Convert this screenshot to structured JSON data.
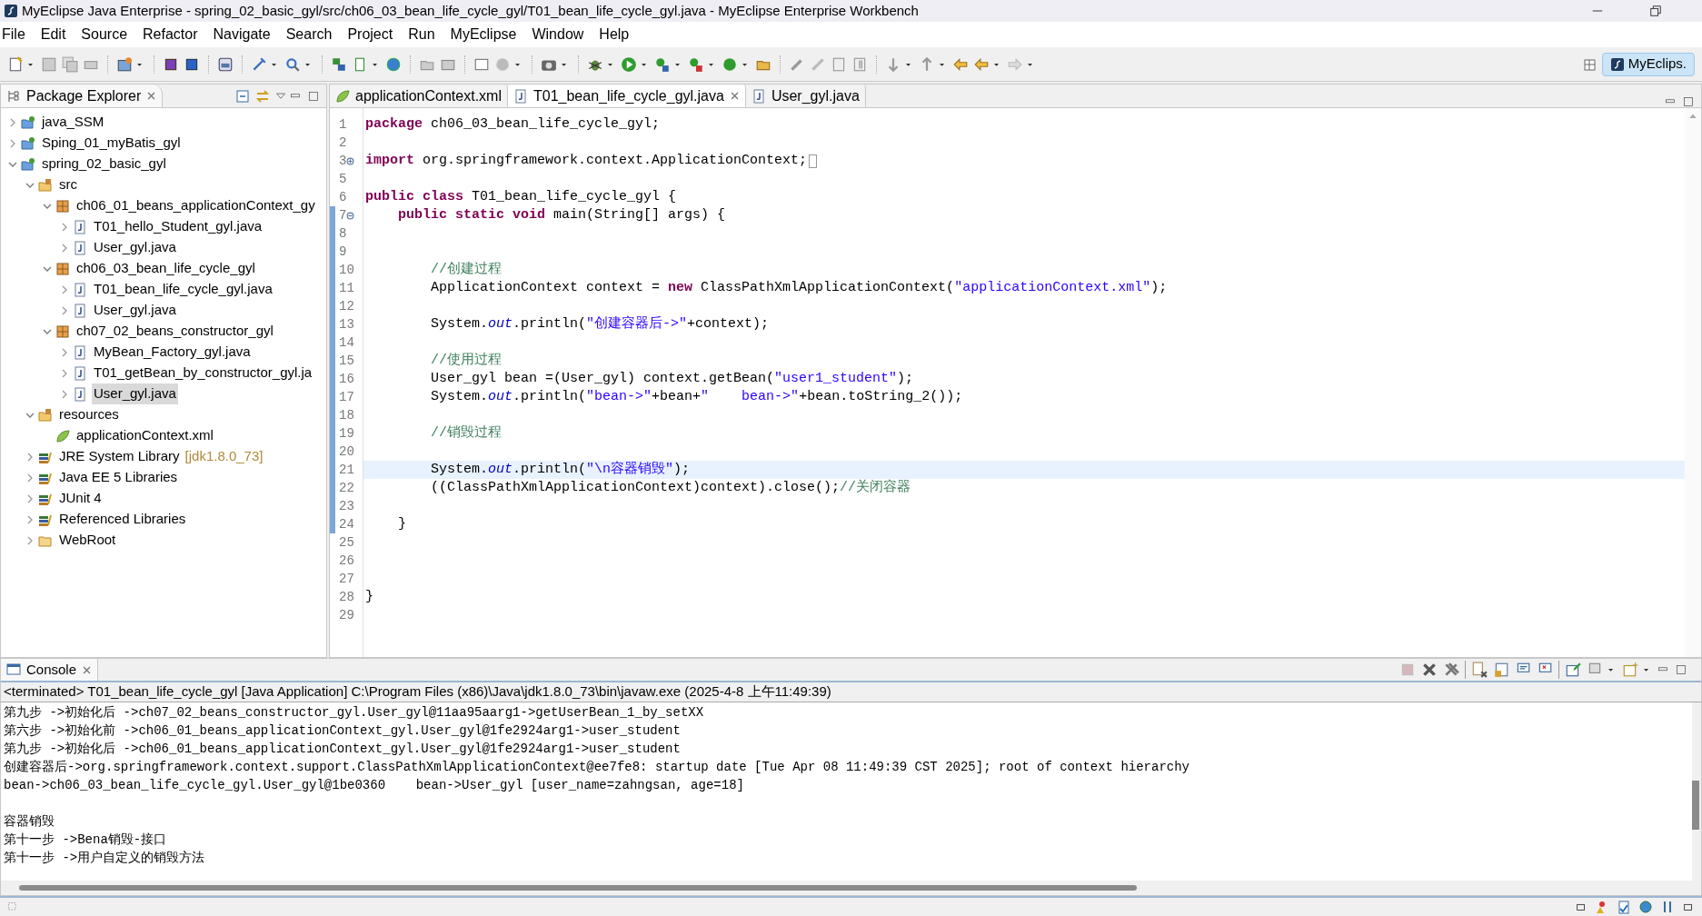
{
  "window": {
    "title": "MyEclipse Java Enterprise - spring_02_basic_gyl/src/ch06_03_bean_life_cycle_gyl/T01_bean_life_cycle_gyl.java - MyEclipse Enterprise Workbench"
  },
  "menu": [
    "File",
    "Edit",
    "Source",
    "Refactor",
    "Navigate",
    "Search",
    "Project",
    "Run",
    "MyEclipse",
    "Window",
    "Help"
  ],
  "perspective": {
    "label": "MyEclips.",
    "selected": true
  },
  "explorer": {
    "title": "Package Explorer",
    "tree": [
      {
        "label": "java_SSM",
        "kind": "project",
        "expanded": false
      },
      {
        "label": "Sping_01_myBatis_gyl",
        "kind": "project",
        "expanded": false
      },
      {
        "label": "spring_02_basic_gyl",
        "kind": "project",
        "expanded": true,
        "children": [
          {
            "label": "src",
            "kind": "source-folder",
            "expanded": true,
            "children": [
              {
                "label": "ch06_01_beans_applicationContext_gy",
                "kind": "package",
                "expanded": true,
                "children": [
                  {
                    "label": "T01_hello_Student_gyl.java",
                    "kind": "java",
                    "expanded": false,
                    "selected": false
                  },
                  {
                    "label": "User_gyl.java",
                    "kind": "java",
                    "expanded": false,
                    "selected": false
                  }
                ]
              },
              {
                "label": "ch06_03_bean_life_cycle_gyl",
                "kind": "package",
                "expanded": true,
                "children": [
                  {
                    "label": "T01_bean_life_cycle_gyl.java",
                    "kind": "java",
                    "expanded": false,
                    "selected": false
                  },
                  {
                    "label": "User_gyl.java",
                    "kind": "java",
                    "expanded": false,
                    "selected": false
                  }
                ]
              },
              {
                "label": "ch07_02_beans_constructor_gyl",
                "kind": "package",
                "expanded": true,
                "children": [
                  {
                    "label": "MyBean_Factory_gyl.java",
                    "kind": "java",
                    "expanded": false,
                    "selected": false
                  },
                  {
                    "label": "T01_getBean_by_constructor_gyl.ja",
                    "kind": "java",
                    "expanded": false,
                    "selected": false
                  },
                  {
                    "label": "User_gyl.java",
                    "kind": "java",
                    "expanded": false,
                    "selected": true
                  }
                ]
              }
            ]
          },
          {
            "label": "resources",
            "kind": "source-folder",
            "expanded": true,
            "children": [
              {
                "label": "applicationContext.xml",
                "kind": "xml",
                "selected": false
              }
            ]
          },
          {
            "label": "JRE System Library",
            "suffix": "[jdk1.8.0_73]",
            "kind": "library",
            "expanded": false
          },
          {
            "label": "Java EE 5 Libraries",
            "kind": "library",
            "expanded": false
          },
          {
            "label": "JUnit 4",
            "kind": "library",
            "expanded": false
          },
          {
            "label": "Referenced Libraries",
            "kind": "library",
            "expanded": false
          },
          {
            "label": "WebRoot",
            "kind": "folder",
            "expanded": false
          }
        ]
      }
    ]
  },
  "editor": {
    "tabs": [
      {
        "label": "applicationContext.xml",
        "kind": "xml",
        "selected": false
      },
      {
        "label": "T01_bean_life_cycle_gyl.java",
        "kind": "java",
        "selected": true
      },
      {
        "label": "User_gyl.java",
        "kind": "java",
        "selected": false
      }
    ],
    "lines": [
      {
        "number": "1",
        "highlighted": false,
        "segments": [
          {
            "kind": "kw",
            "text": "package"
          },
          {
            "kind": "plain",
            "text": " ch06_03_bean_life_cycle_gyl;"
          }
        ]
      },
      {
        "number": "2",
        "highlighted": false
      },
      {
        "number": "3",
        "collapsed": true,
        "highlighted": false,
        "segments": [
          {
            "kind": "kw",
            "text": "import"
          },
          {
            "kind": "plain",
            "text": " org.springframework.context.ApplicationContext;"
          }
        ]
      },
      {
        "number": "5",
        "highlighted": false
      },
      {
        "number": "6",
        "highlighted": false,
        "segments": [
          {
            "kind": "kw",
            "text": "public class"
          },
          {
            "kind": "plain",
            "text": " T01_bean_life_cycle_gyl {"
          }
        ]
      },
      {
        "number": "7",
        "collapsed": false,
        "highlighted": false,
        "segments": [
          {
            "kind": "kw",
            "text": "    public static void"
          },
          {
            "kind": "plain",
            "text": " main(String[] args) {"
          }
        ]
      },
      {
        "number": "8",
        "highlighted": false
      },
      {
        "number": "9",
        "highlighted": false
      },
      {
        "number": "10",
        "highlighted": false,
        "segments": [
          {
            "kind": "comment",
            "text": "        //创建过程"
          }
        ]
      },
      {
        "number": "11",
        "highlighted": false,
        "segments": [
          {
            "kind": "plain",
            "text": "        ApplicationContext context = "
          },
          {
            "kind": "kw",
            "text": "new"
          },
          {
            "kind": "plain",
            "text": " ClassPathXmlApplicationContext("
          },
          {
            "kind": "str",
            "text": "\"applicationContext.xml\""
          },
          {
            "kind": "plain",
            "text": ");"
          }
        ]
      },
      {
        "number": "12",
        "highlighted": false
      },
      {
        "number": "13",
        "highlighted": false,
        "segments": [
          {
            "kind": "plain",
            "text": "        System."
          },
          {
            "kind": "field",
            "text": "out"
          },
          {
            "kind": "plain",
            "text": ".println("
          },
          {
            "kind": "str",
            "text": "\"创建容器后->\""
          },
          {
            "kind": "plain",
            "text": "+context);"
          }
        ]
      },
      {
        "number": "14",
        "highlighted": false
      },
      {
        "number": "15",
        "highlighted": false,
        "segments": [
          {
            "kind": "comment",
            "text": "        //使用过程"
          }
        ]
      },
      {
        "number": "16",
        "highlighted": false,
        "segments": [
          {
            "kind": "plain",
            "text": "        User_gyl bean =(User_gyl) context.getBean("
          },
          {
            "kind": "str",
            "text": "\"user1_student\""
          },
          {
            "kind": "plain",
            "text": ");"
          }
        ]
      },
      {
        "number": "17",
        "highlighted": false,
        "segments": [
          {
            "kind": "plain",
            "text": "        System."
          },
          {
            "kind": "field",
            "text": "out"
          },
          {
            "kind": "plain",
            "text": ".println("
          },
          {
            "kind": "str",
            "text": "\"bean->\""
          },
          {
            "kind": "plain",
            "text": "+bean+"
          },
          {
            "kind": "str",
            "text": "\"    bean->\""
          },
          {
            "kind": "plain",
            "text": "+bean.toString_2());"
          }
        ]
      },
      {
        "number": "18",
        "highlighted": false
      },
      {
        "number": "19",
        "highlighted": false,
        "segments": [
          {
            "kind": "comment",
            "text": "        //销毁过程"
          }
        ]
      },
      {
        "number": "20",
        "highlighted": false
      },
      {
        "number": "21",
        "highlighted": true,
        "segments": [
          {
            "kind": "plain",
            "text": "        System."
          },
          {
            "kind": "field",
            "text": "out"
          },
          {
            "kind": "plain",
            "text": ".println("
          },
          {
            "kind": "str",
            "text": "\"\\n容器销毁\""
          },
          {
            "kind": "plain",
            "text": ");"
          }
        ]
      },
      {
        "number": "22",
        "highlighted": false,
        "segments": [
          {
            "kind": "plain",
            "text": "        ((ClassPathXmlApplicationContext)context).close();"
          },
          {
            "kind": "comment",
            "text": "//关闭容器"
          }
        ]
      },
      {
        "number": "23",
        "highlighted": false
      },
      {
        "number": "24",
        "highlighted": false,
        "segments": [
          {
            "kind": "plain",
            "text": "    }"
          }
        ]
      },
      {
        "number": "25",
        "highlighted": false
      },
      {
        "number": "26",
        "highlighted": false
      },
      {
        "number": "27",
        "highlighted": false
      },
      {
        "number": "28",
        "highlighted": false,
        "segments": [
          {
            "kind": "plain",
            "text": "}"
          }
        ]
      },
      {
        "number": "29",
        "highlighted": false
      }
    ]
  },
  "console": {
    "title": "Console",
    "header": "<terminated> T01_bean_life_cycle_gyl [Java Application] C:\\Program Files (x86)\\Java\\jdk1.8.0_73\\bin\\javaw.exe (2025-4-8 上午11:49:39)",
    "blocks": [
      [
        "第九步 ->初始化后 ->ch07_02_beans_constructor_gyl.User_gyl@11aa95aarg1->getUserBean_1_by_setXX",
        "第六步 ->初始化前 ->ch06_01_beans_applicationContext_gyl.User_gyl@1fe2924arg1->user_student",
        "第九步 ->初始化后 ->ch06_01_beans_applicationContext_gyl.User_gyl@1fe2924arg1->user_student",
        "创建容器后->org.springframework.context.support.ClassPathXmlApplicationContext@ee7fe8: startup date [Tue Apr 08 11:49:39 CST 2025]; root of context hierarchy",
        "bean->ch06_03_bean_life_cycle_gyl.User_gyl@1be0360    bean->User_gyl [user_name=zahngsan, age=18]"
      ],
      [
        "容器销毁",
        "第十一步 ->Bena销毁-接口",
        "第十一步 ->用户自定义的销毁方法"
      ]
    ]
  }
}
